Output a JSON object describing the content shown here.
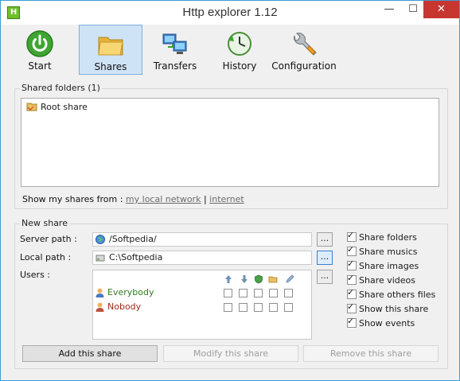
{
  "window": {
    "title": "Http explorer 1.12",
    "icon_letter": "H",
    "minimize": "—",
    "maximize": "☐",
    "close": "✕"
  },
  "toolbar": {
    "start": "Start",
    "shares": "Shares",
    "transfers": "Transfers",
    "history": "History",
    "configuration": "Configuration"
  },
  "shared_folders": {
    "title": "Shared folders (1)",
    "items": [
      "Root share"
    ],
    "show_prefix": "Show my shares from :",
    "link_local": "my local network",
    "separator": "|",
    "link_internet": "internet"
  },
  "new_share": {
    "title": "New share",
    "server_path_label": "Server path :",
    "server_path_value": "/Softpedia/",
    "local_path_label": "Local path :",
    "local_path_value": "C:\\Softpedia",
    "users_label": "Users :",
    "browse": "...",
    "users": [
      {
        "name": "Everybody",
        "color": "#2f7d1f"
      },
      {
        "name": "Nobody",
        "color": "#9a2a1a"
      }
    ],
    "options": [
      {
        "label": "Share folders",
        "checked": true
      },
      {
        "label": "Share musics",
        "checked": true
      },
      {
        "label": "Share images",
        "checked": true
      },
      {
        "label": "Share videos",
        "checked": true
      },
      {
        "label": "Share others files",
        "checked": true
      },
      {
        "label": "Show this share",
        "checked": true
      },
      {
        "label": "Show events",
        "checked": true
      }
    ],
    "permission_icons": [
      "upload-arrow-icon",
      "download-arrow-icon",
      "shield-icon",
      "folder-open-icon",
      "pencil-icon"
    ]
  },
  "buttons": {
    "add": "Add this share",
    "modify": "Modify this share",
    "remove": "Remove this share"
  }
}
